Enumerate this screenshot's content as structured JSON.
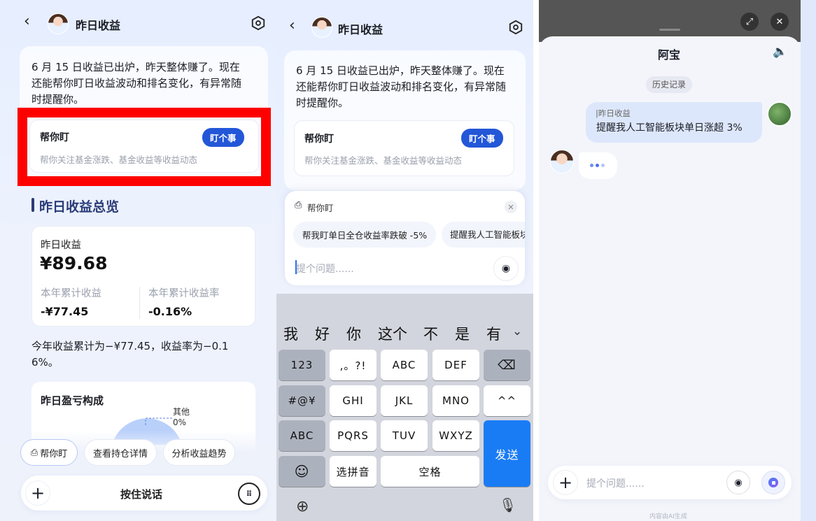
{
  "panel1": {
    "header_title": "昨日收益",
    "intro_text_lines": [
      "6 月 15 日收益已出炉，昨天整体赚了。现在",
      "还能帮你盯日收益波动和排名变化，有异常随",
      "时提醒你。"
    ],
    "watch_card": {
      "title": "帮你盯",
      "button": "盯个事",
      "desc": "帮你关注基金涨跌、基金收益等收益动态"
    },
    "overview_title": "昨日收益总览",
    "yesterday_label": "昨日收益",
    "yesterday_value": "¥89.68",
    "ytd_label": "本年累计收益",
    "ytd_value": "-¥77.45",
    "ytd_rate_label": "本年累计收益率",
    "ytd_rate_value": "-0.16%",
    "summary_line1": "今年收益累计为−¥77.45，收益率为−0.1",
    "summary_line2": "6%。",
    "composition_title": "昨日盈亏构成",
    "pie_other_label": "其他",
    "pie_other_value": "0%",
    "chips": [
      "帮你盯",
      "查看持仓详情",
      "分析收益趋势"
    ],
    "voice_label": "按住说话"
  },
  "panel2": {
    "header_title": "昨日收益",
    "intro_text_lines": [
      "6 月 15 日收益已出炉，昨天整体赚了。现在",
      "还能帮你盯日收益波动和排名变化，有异常随",
      "时提醒你。"
    ],
    "watch_card": {
      "title": "帮你盯",
      "button": "盯个事",
      "desc": "帮你关注基金涨跌、基金收益等收益动态"
    },
    "popup_title": "帮你盯",
    "suggestions": [
      "帮我盯单日全仓收益率跌破 -5%",
      "提醒我人工智能板块"
    ],
    "input_placeholder": "提个问题......",
    "candidates": [
      "我",
      "好",
      "你",
      "这个",
      "不",
      "是",
      "有"
    ],
    "keys_row1": [
      "123",
      ",。?!",
      "ABC",
      "DEF"
    ],
    "keys_row2": [
      "#@¥",
      "GHI",
      "JKL",
      "MNO",
      "^^"
    ],
    "keys_row3": [
      "ABC",
      "PQRS",
      "TUV",
      "WXYZ"
    ],
    "send_key": "发送",
    "key_pinyin": "选拼音",
    "key_space": "空格"
  },
  "panel3": {
    "title": "阿宝",
    "history": "历史记录",
    "user_msg_tag": "|昨日收益",
    "user_msg": "提醒我人工智能板块单日涨超 3%",
    "input_placeholder": "提个问题......",
    "footer_note": "内容由AI生成"
  },
  "colors": {
    "accent": "#2357d8",
    "send": "#1a7cf5",
    "highlight_box": "#ff0000"
  }
}
